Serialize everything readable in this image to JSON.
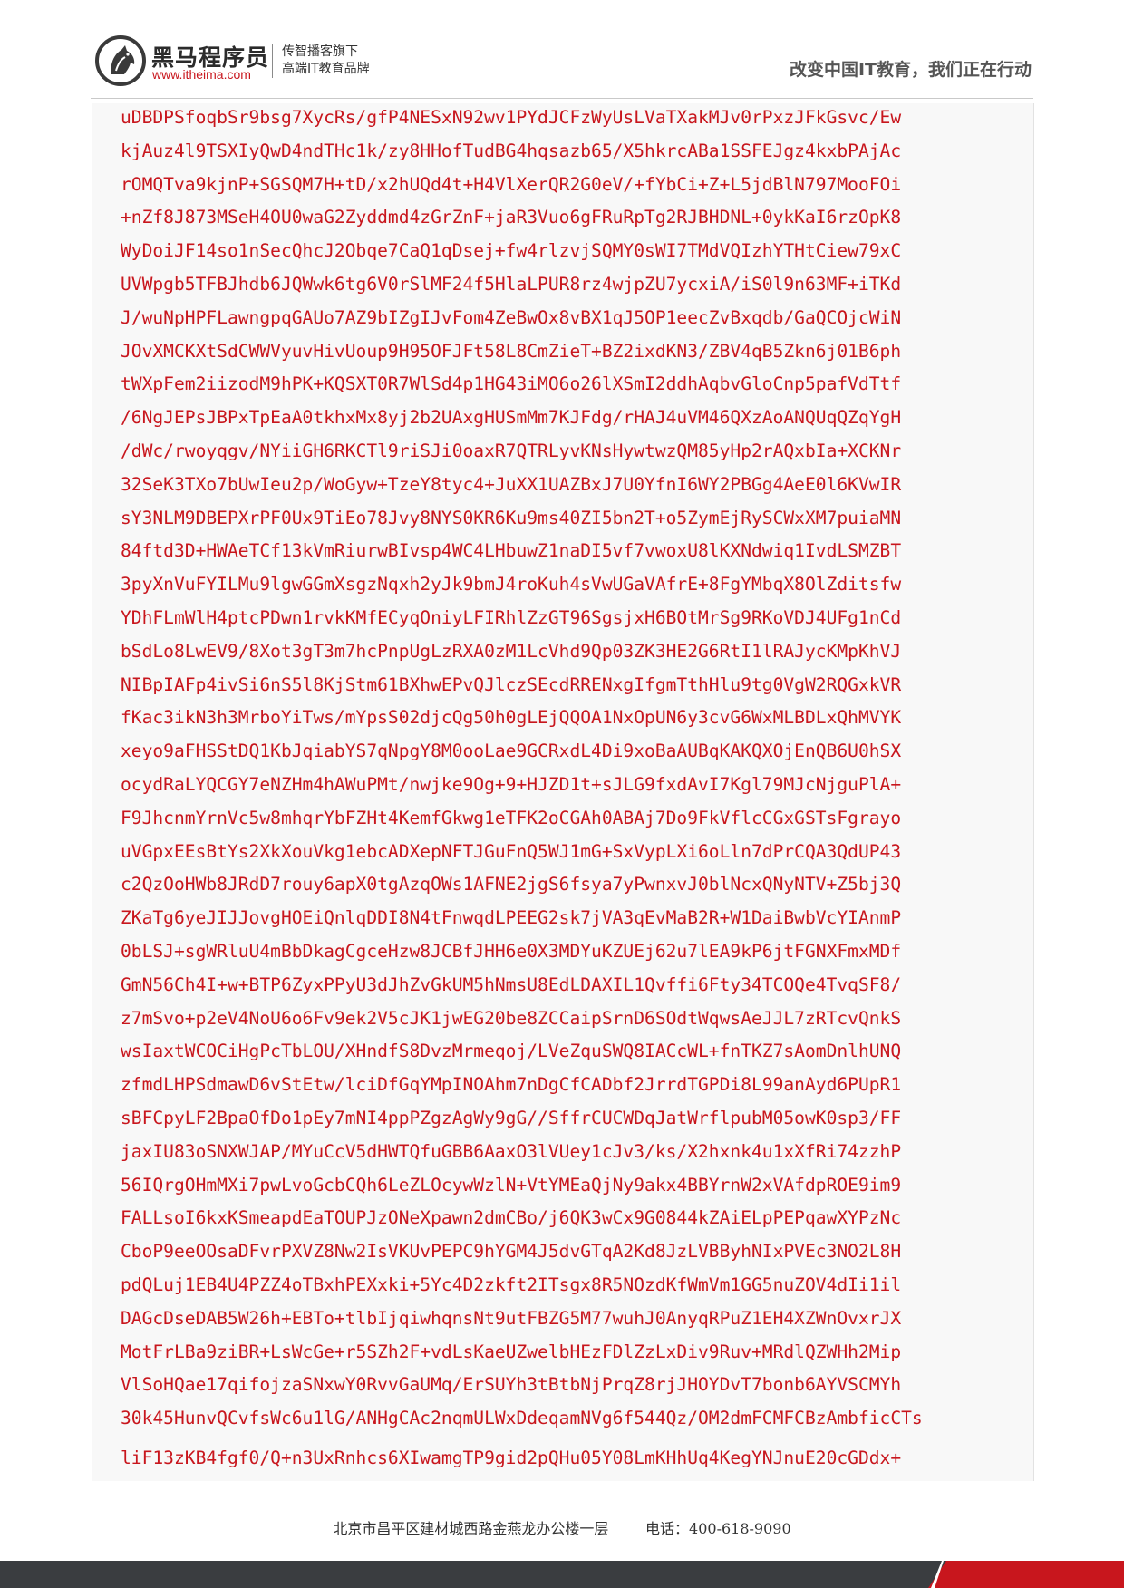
{
  "header": {
    "brand_name": "黑马程序员",
    "brand_url": "www.itheima.com",
    "slogan_line1": "传智播客旗下",
    "slogan_line2": "高端IT教育品牌",
    "motto": "改变中国IT教育，我们正在行动"
  },
  "code_lines": [
    "uDBDPSfoqbSr9bsg7XycRs/gfP4NESxN92wv1PYdJCFzWyUsLVaTXakMJv0rPxzJFkGsvc/Ew",
    "kjAuz4l9TSXIyQwD4ndTHc1k/zy8HHofTudBG4hqsazb65/X5hkrcABa1SSFEJgz4kxbPAjAc",
    "rOMQTva9kjnP+SGSQM7H+tD/x2hUQd4t+H4VlXerQR2G0eV/+fYbCi+Z+L5jdBlN797MooFOi",
    "+nZf8J873MSeH4OU0waG2Zyddmd4zGrZnF+jaR3Vuo6gFRuRpTg2RJBHDNL+0ykKaI6rzOpK8",
    "WyDoiJF14so1nSecQhcJ2Obqe7CaQ1qDsej+fw4rlzvjSQMY0sWI7TMdVQIzhYTHtCiew79xC",
    "UVWpgb5TFBJhdb6JQWwk6tg6V0rSlMF24f5HlaLPUR8rz4wjpZU7ycxiA/iS0l9n63MF+iTKd",
    "J/wuNpHPFLawngpqGAUo7AZ9bIZgIJvFom4ZeBwOx8vBX1qJ5OP1eecZvBxqdb/GaQCOjcWiN",
    "JOvXMCKXtSdCWWVyuvHivUoup9H95OFJFt58L8CmZieT+BZ2ixdKN3/ZBV4qB5Zkn6j01B6ph",
    "tWXpFem2iizodM9hPK+KQSXT0R7WlSd4p1HG43iMO6o26lXSmI2ddhAqbvGloCnp5pafVdTtf",
    "/6NgJEPsJBPxTpEaA0tkhxMx8yj2b2UAxgHUSmMm7KJFdg/rHAJ4uVM46QXzAoANQUqQZqYgH",
    "/dWc/rwoyqgv/NYiiGH6RKCTl9riSJi0oaxR7QTRLyvKNsHywtwzQM85yHp2rAQxbIa+XCKNr",
    "32SeK3TXo7bUwIeu2p/WoGyw+TzeY8tyc4+JuXX1UAZBxJ7U0YfnI6WY2PBGg4AeE0l6KVwIR",
    "sY3NLM9DBEPXrPF0Ux9TiEo78Jvy8NYS0KR6Ku9ms40ZI5bn2T+o5ZymEjRySCWxXM7puiaMN",
    "84ftd3D+HWAeTCf13kVmRiurwBIvsp4WC4LHbuwZ1naDI5vf7vwoxU8lKXNdwiq1IvdLSMZBT",
    "3pyXnVuFYILMu9lgwGGmXsgzNqxh2yJk9bmJ4roKuh4sVwUGaVAfrE+8FgYMbqX8OlZditsfw",
    "YDhFLmWlH4ptcPDwn1rvkKMfECyqOniyLFIRhlZzGT96SgsjxH6BOtMrSg9RKoVDJ4UFg1nCd",
    "bSdLo8LwEV9/8Xot3gT3m7hcPnpUgLzRXA0zM1LcVhd9Qp03ZK3HE2G6RtI1lRAJycKMpKhVJ",
    "NIBpIAFp4ivSi6nS5l8KjStm61BXhwEPvQJlczSEcdRRENxgIfgmTthHlu9tg0VgW2RQGxkVR",
    "fKac3ikN3h3MrboYiTws/mYpsS02djcQg50h0gLEjQQOA1NxOpUN6y3cvG6WxMLBDLxQhMVYK",
    "xeyo9aFHSStDQ1KbJqiabYS7qNpgY8M0ooLae9GCRxdL4Di9xoBaAUBqKAKQXOjEnQB6U0hSX",
    "ocydRaLYQCGY7eNZHm4hAWuPMt/nwjke9Og+9+HJZD1t+sJLG9fxdAvI7Kgl79MJcNjguPlA+",
    "F9JhcnmYrnVc5w8mhqrYbFZHt4KemfGkwg1eTFK2oCGAh0ABAj7Do9FkVflcCGxGSTsFgrayo",
    "uVGpxEEsBtYs2XkXouVkg1ebcADXepNFTJGuFnQ5WJ1mG+SxVypLXi6oLln7dPrCQA3QdUP43",
    "c2QzOoHWb8JRdD7rouy6apX0tgAzqOWs1AFNE2jgS6fsya7yPwnxvJ0blNcxQNyNTV+Z5bj3Q",
    "ZKaTg6yeJIJJovgHOEiQnlqDDI8N4tFnwqdLPEEG2sk7jVA3qEvMaB2R+W1DaiBwbVcYIAnmP",
    "0bLSJ+sgWRluU4mBbDkagCgceHzw8JCBfJHH6e0X3MDYuKZUEj62u7lEA9kP6jtFGNXFmxMDf",
    "GmN56Ch4I+w+BTP6ZyxPPyU3dJhZvGkUM5hNmsU8EdLDAXIL1Qvffi6Fty34TCOQe4TvqSF8/",
    "z7mSvo+p2eV4NoU6o6Fv9ek2V5cJK1jwEG20be8ZCCaipSrnD6SOdtWqwsAeJJL7zRTcvQnkS",
    "wsIaxtWCOCiHgPcTbLOU/XHndfS8DvzMrmeqoj/LVeZquSWQ8IACcWL+fnTKZ7sAomDnlhUNQ",
    "zfmdLHPSdmawD6vStEtw/lciDfGqYMpINOAhm7nDgCfCADbf2JrrdTGPDi8L99anAyd6PUpR1",
    "sBFCpyLF2BpaOfDo1pEy7mNI4ppPZgzAgWy9gG//SffrCUCWDqJatWrflpubM05owK0sp3/FF",
    "jaxIU83oSNXWJAP/MYuCcV5dHWTQfuGBB6AaxO3lVUey1cJv3/ks/X2hxnk4u1xXfRi74zzhP",
    "56IQrgOHmMXi7pwLvoGcbCQh6LeZLOcywWzlN+VtYMEaQjNy9akx4BBYrnW2xVAfdpROE9im9",
    "FALLsoI6kxKSmeapdEaTOUPJzONeXpawn2dmCBo/j6QK3wCx9G0844kZAiELpPEPqawXYPzNc",
    "CboP9eeOOsaDFvrPXVZ8Nw2IsVKUvPEPC9hYGM4J5dvGTqA2Kd8JzLVBByhNIxPVEc3NO2L8H",
    "pdQLuj1EB4U4PZZ4oTBxhPEXxki+5Yc4D2zkft2ITsgx8R5NOzdKfWmVm1GG5nuZOV4dIi1il",
    "DAGcDseDAB5W26h+EBTo+tlbIjqiwhqnsNt9utFBZG5M77wuhJ0AnyqRPuZ1EH4XZWnOvxrJX",
    "MotFrLBa9ziBR+LsWcGe+r5SZh2F+vdLsKaeUZwelbHEzFDlZzLxDiv9Ruv+MRdlQZWHh2Mip",
    "VlSoHQae17qifojzaSNxwY0RvvGaUMq/ErSUYh3tBtbNjPrqZ8rjJHOYDvT7bonb6AYVSCMYh",
    "30k45HunvQCvfsWc6u1lG/ANHgCAc2nqmULWxDdeqamNVg6f544Qz/OM2dmFCMFCBzAmbficCTs",
    "liF13zKB4fgf0/Q+n3UxRnhcs6XIwamgTP9gid2pQHu05Y08LmKHhUq4KegYNJnuE20cGDdx+"
  ],
  "footer": {
    "address": "北京市昌平区建材城西路金燕龙办公楼一层",
    "phone": "电话：400-618-9090"
  },
  "colors": {
    "brand_red": "#c8161d",
    "footer_dark": "#3a3d40",
    "code_background": "#f8f8f8"
  }
}
